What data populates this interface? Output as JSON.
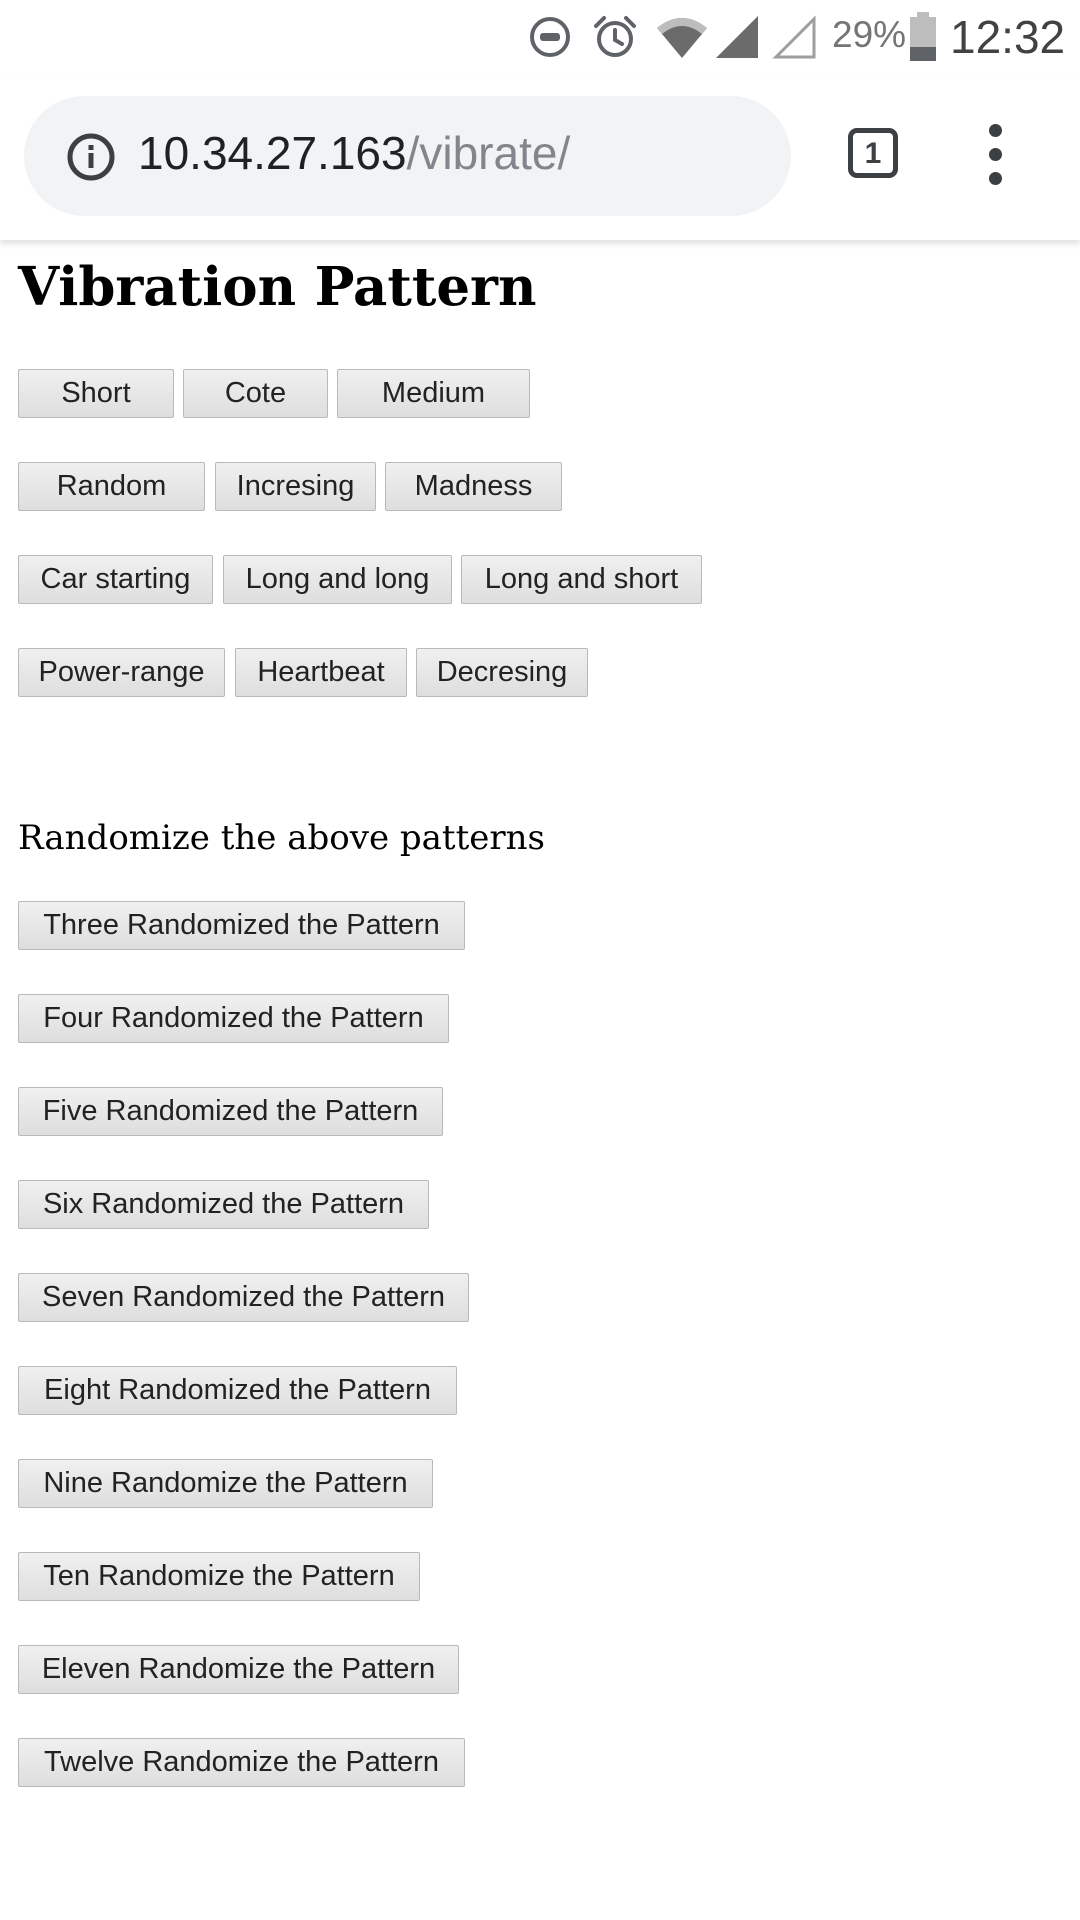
{
  "status_bar": {
    "battery_percent": "29%",
    "time": "12:32",
    "icons": [
      "dnd-icon",
      "alarm-icon",
      "wifi-icon",
      "signal-icon",
      "signal-empty-icon",
      "battery-icon"
    ]
  },
  "browser": {
    "url_host": "10.34.27.163",
    "url_path": "/vibrate/",
    "tab_count": "1",
    "icons": [
      "info-icon",
      "tab-switcher-icon",
      "menu-icon"
    ]
  },
  "page": {
    "title": "Vibration Pattern",
    "pattern_rows": [
      [
        "Short",
        "Cote",
        "Medium"
      ],
      [
        "Random",
        "Incresing",
        "Madness"
      ],
      [
        "Car starting",
        "Long and long",
        "Long and short"
      ],
      [
        "Power-range",
        "Heartbeat",
        "Decresing"
      ]
    ],
    "randomize_heading": "Randomize the above patterns",
    "randomize_buttons": [
      "Three Randomized the Pattern",
      "Four Randomized the Pattern",
      "Five Randomized the Pattern",
      "Six Randomized the Pattern",
      "Seven Randomized the Pattern",
      "Eight Randomized the Pattern",
      "Nine Randomize the Pattern",
      "Ten Randomize the Pattern",
      "Eleven Randomize the Pattern",
      "Twelve Randomize the Pattern"
    ]
  },
  "colors": {
    "omnibox_bg": "#f1f3f4",
    "url_path_gray": "#80868b",
    "button_border": "#b9b9b9"
  }
}
